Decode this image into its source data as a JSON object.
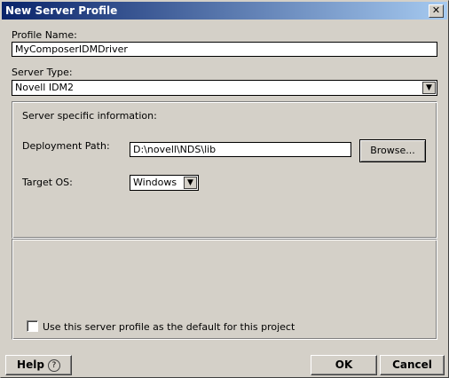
{
  "window": {
    "title": "New Server Profile",
    "close_glyph": "✕"
  },
  "form": {
    "profile_name_label": "Profile Name:",
    "profile_name_value": "MyComposerIDMDriver",
    "server_type_label": "Server Type:",
    "server_type_value": "Novell IDM2"
  },
  "server_info": {
    "heading": "Server specific information:",
    "deployment_path_label": "Deployment Path:",
    "deployment_path_value": "D:\\novell\\NDS\\lib",
    "browse_label": "Browse...",
    "target_os_label": "Target OS:",
    "target_os_value": "Windows"
  },
  "default_checkbox": {
    "label": "Use this server profile as the default for this project",
    "checked": false
  },
  "footer": {
    "help_label": "Help",
    "help_icon_glyph": "?",
    "ok_label": "OK",
    "cancel_label": "Cancel"
  },
  "colors": {
    "title_start": "#0a246a",
    "title_end": "#a6caf0",
    "face": "#d4d0c8"
  }
}
